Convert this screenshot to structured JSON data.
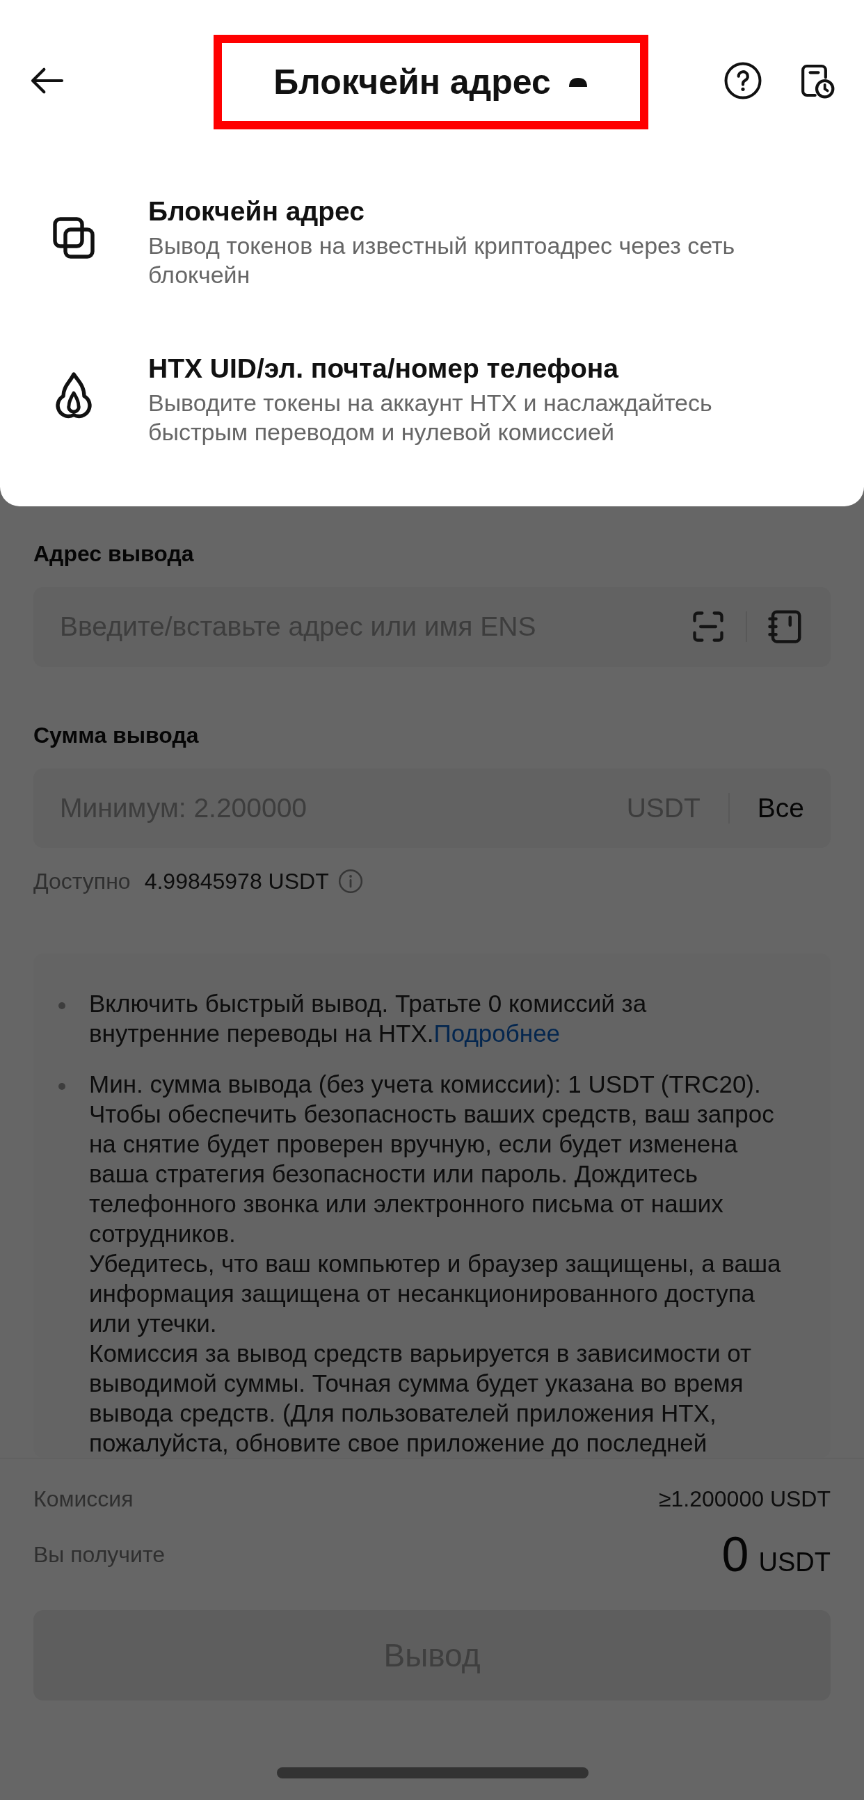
{
  "header": {
    "title": "Блокчейн адрес",
    "expanded": true,
    "highlighted": true
  },
  "menu_items": [
    {
      "kind": "stack",
      "title": "Блокчейн адрес",
      "description": "Вывод токенов на известный криптоадрес через сеть блокчейн"
    },
    {
      "kind": "flame",
      "title": "HTX UID/эл. почта/номер телефона",
      "description": "Выводите токены на аккаунт HTX и наслаждайтесь быстрым переводом и нулевой комиссией"
    }
  ],
  "address": {
    "label": "Адрес вывода",
    "placeholder": "Введите/вставьте адрес или имя ENS"
  },
  "amount": {
    "label": "Сумма вывода",
    "placeholder": "Минимум: 2.200000",
    "currency": "USDT",
    "max_button": "Все"
  },
  "available": {
    "label": "Доступно",
    "value": "4.99845978 USDT"
  },
  "notes": [
    {
      "text": "Включить быстрый вывод. Тратьте 0 комиссий за внутренние переводы на HTX.",
      "link": "Подробнее"
    },
    {
      "text": "Мин. сумма вывода (без учета комиссии): 1 USDT (TRC20).\nЧтобы обеспечить безопасность ваших средств, ваш запрос на снятие будет проверен вручную, если будет изменена ваша стратегия безопасности или пароль. Дождитесь телефонного звонка или электронного письма от наших сотрудников.\nУбедитесь, что ваш компьютер и браузер защищены, а ваша информация защищена от несанкционированного доступа или утечки.\nКомиссия за вывод средств варьируется в зависимости от выводимой суммы. Точная сумма будет указана во время вывода средств. (Для пользователей приложения HTX, пожалуйста, обновите свое приложение до последней"
    }
  ],
  "summary": {
    "fee_label": "Комиссия",
    "fee_value": "≥1.200000 USDT",
    "receive_label": "Вы получите",
    "receive_amount": "0",
    "receive_currency": "USDT"
  },
  "submit": {
    "label": "Вывод",
    "disabled": true
  }
}
